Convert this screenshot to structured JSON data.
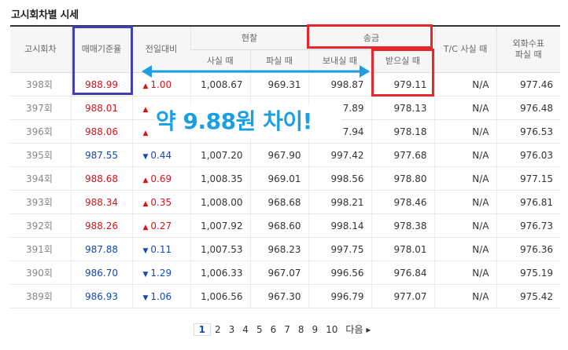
{
  "title": "고시회차별 시세",
  "headers": {
    "round": "고시회차",
    "base": "매매기준율",
    "diff": "전일대비",
    "cash": "현찰",
    "transfer": "송금",
    "tc": "T/C 사실 때",
    "fx": "외화수표 파실 때",
    "cash_buy": "사실 때",
    "cash_sell": "파실 때",
    "send": "보내실 때",
    "receive": "받으실 때"
  },
  "rows": [
    {
      "round": "398회",
      "base": "988.99",
      "dir": "up",
      "diff": "1.00",
      "cash_buy": "1,008.67",
      "cash_sell": "969.31",
      "send": "998.87",
      "receive": "979.11",
      "tc": "N/A",
      "fx": "977.46"
    },
    {
      "round": "397회",
      "base": "988.01",
      "dir": "up",
      "diff": "",
      "cash_buy": "",
      "cash_sell": "",
      "send": "7.89",
      "receive": "978.13",
      "tc": "N/A",
      "fx": "976.48"
    },
    {
      "round": "396회",
      "base": "988.06",
      "dir": "up",
      "diff": "",
      "cash_buy": "",
      "cash_sell": "",
      "send": "7.94",
      "receive": "978.18",
      "tc": "N/A",
      "fx": "976.53"
    },
    {
      "round": "395회",
      "base": "987.55",
      "dir": "down",
      "diff": "0.44",
      "cash_buy": "1,007.20",
      "cash_sell": "967.90",
      "send": "997.42",
      "receive": "977.68",
      "tc": "N/A",
      "fx": "976.03"
    },
    {
      "round": "394회",
      "base": "988.68",
      "dir": "up",
      "diff": "0.69",
      "cash_buy": "1,008.35",
      "cash_sell": "969.01",
      "send": "998.56",
      "receive": "978.80",
      "tc": "N/A",
      "fx": "977.15"
    },
    {
      "round": "393회",
      "base": "988.34",
      "dir": "up",
      "diff": "0.35",
      "cash_buy": "1,008.00",
      "cash_sell": "968.68",
      "send": "998.21",
      "receive": "978.46",
      "tc": "N/A",
      "fx": "976.81"
    },
    {
      "round": "392회",
      "base": "988.26",
      "dir": "up",
      "diff": "0.27",
      "cash_buy": "1,007.92",
      "cash_sell": "968.60",
      "send": "998.14",
      "receive": "978.38",
      "tc": "N/A",
      "fx": "976.73"
    },
    {
      "round": "391회",
      "base": "987.88",
      "dir": "down",
      "diff": "0.11",
      "cash_buy": "1,007.53",
      "cash_sell": "968.23",
      "send": "997.75",
      "receive": "978.01",
      "tc": "N/A",
      "fx": "976.36"
    },
    {
      "round": "390회",
      "base": "986.70",
      "dir": "down",
      "diff": "1.29",
      "cash_buy": "1,006.33",
      "cash_sell": "967.07",
      "send": "996.56",
      "receive": "976.84",
      "tc": "N/A",
      "fx": "975.19"
    },
    {
      "round": "389회",
      "base": "986.93",
      "dir": "down",
      "diff": "1.06",
      "cash_buy": "1,006.56",
      "cash_sell": "967.30",
      "send": "996.79",
      "receive": "977.07",
      "tc": "N/A",
      "fx": "975.42"
    }
  ],
  "arrow_glyphs": {
    "up": "▲",
    "down": "▼"
  },
  "pagination": {
    "pages": [
      "1",
      "2",
      "3",
      "4",
      "5",
      "6",
      "7",
      "8",
      "9",
      "10"
    ],
    "current": "1",
    "next": "다음 ▸"
  },
  "annotation": {
    "callout": "약 9.88원 차이!"
  },
  "colors": {
    "up": "#d4141b",
    "down": "#1448b4",
    "callout": "#1aa0e0",
    "highlight_blue": "#3f3fb6",
    "highlight_red": "#e8262b"
  }
}
